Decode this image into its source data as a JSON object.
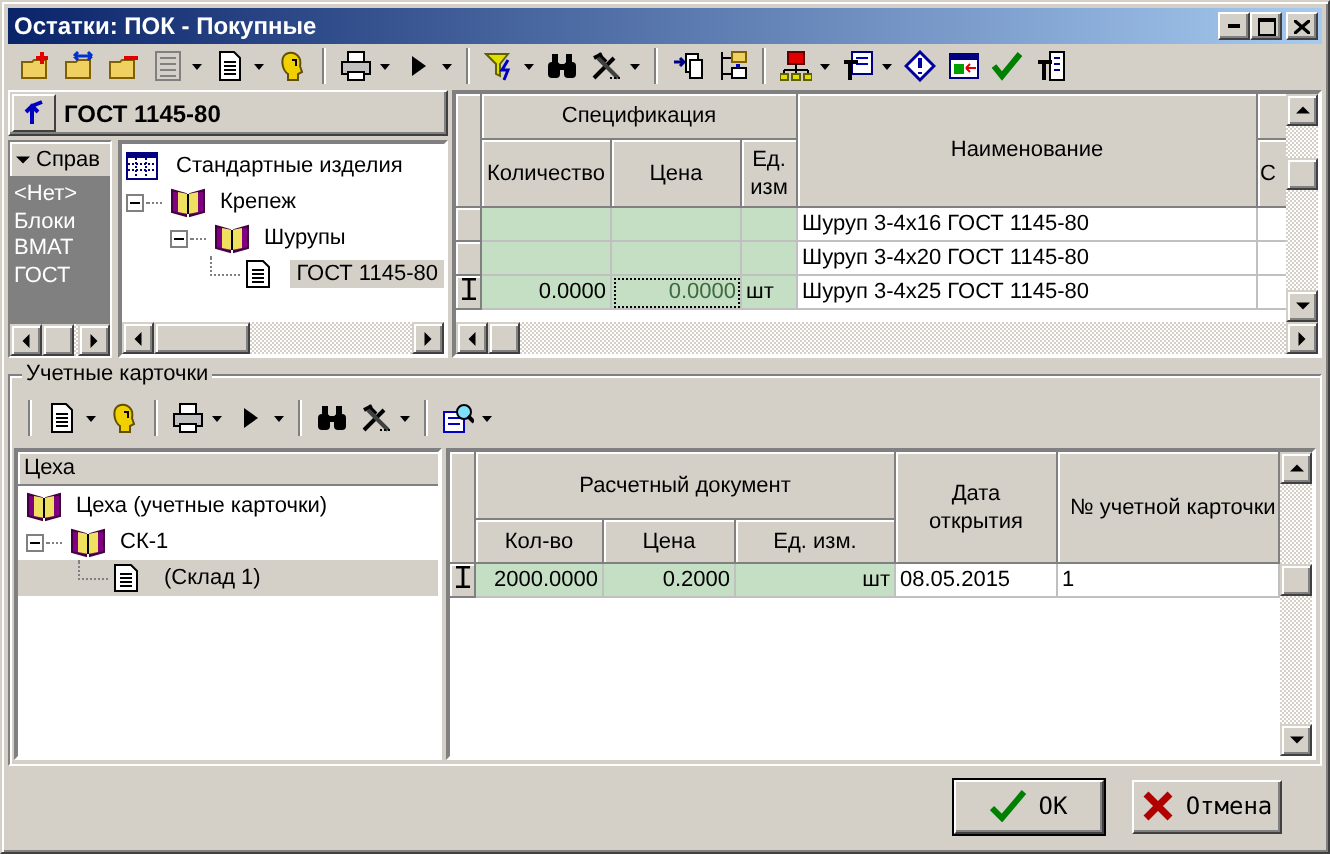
{
  "window": {
    "title": "Остатки: ПОК - Покупные"
  },
  "catalog": {
    "title": "ГОСТ 1145-80",
    "reference": {
      "label": "Справ",
      "items": [
        "<Нет>",
        "Блоки",
        "ВМАТ",
        "ГОСТ"
      ]
    },
    "tree": [
      {
        "label": "Стандартные изделия",
        "kind": "table",
        "selected": false,
        "children": [
          {
            "label": "Крепеж",
            "kind": "book",
            "selected": false,
            "expanded": true,
            "children": [
              {
                "label": "Шурупы",
                "kind": "book",
                "selected": false,
                "expanded": true,
                "children": [
                  {
                    "label": "ГОСТ 1145-80",
                    "kind": "document",
                    "selected": true
                  }
                ]
              }
            ]
          }
        ]
      }
    ]
  },
  "specification": {
    "group": "Спецификация",
    "columns": [
      "Количество",
      "Цена",
      "Ед. изм"
    ],
    "name_column": "Наименование",
    "column_5": {
      "subheader": "С"
    },
    "rows": [
      {
        "current": false,
        "price_focused": false,
        "name": "Шуруп 3-4x16 ГОСТ 1145-80"
      },
      {
        "current": false,
        "price_focused": false,
        "name": "Шуруп 3-4x20 ГОСТ 1145-80"
      },
      {
        "current": true,
        "price_focused": true,
        "quantity": "0.0000",
        "price": "0.0000",
        "unit": "шт",
        "name": "Шуруп 3-4x25 ГОСТ 1145-80"
      }
    ]
  },
  "cards": {
    "title": "Учетные карточки",
    "tree_header": "Цеха",
    "tree": [
      {
        "label": "Цеха (учетные карточки)",
        "kind": "book",
        "selected": false,
        "children": [
          {
            "label": "СК-1",
            "kind": "book",
            "selected": false,
            "expanded": true,
            "children": [
              {
                "label": "(Склад 1)",
                "kind": "document",
                "selected": true
              }
            ]
          }
        ]
      }
    ],
    "grid": {
      "group": "Расчетный документ",
      "columns": [
        "Кол-во",
        "Цена",
        "Ед. изм."
      ],
      "date_column": "Дата открытия",
      "number_column": "№ учетной карточки",
      "rows": [
        {
          "current": true,
          "quantity": "2000.0000",
          "price": "0.2000",
          "unit": "шт",
          "date": "08.05.2015",
          "number": "1"
        }
      ]
    }
  },
  "buttons": [
    {
      "label": "OK",
      "kind": "ok",
      "default": true
    },
    {
      "label": "Отмена",
      "kind": "cancel",
      "default": false
    }
  ]
}
